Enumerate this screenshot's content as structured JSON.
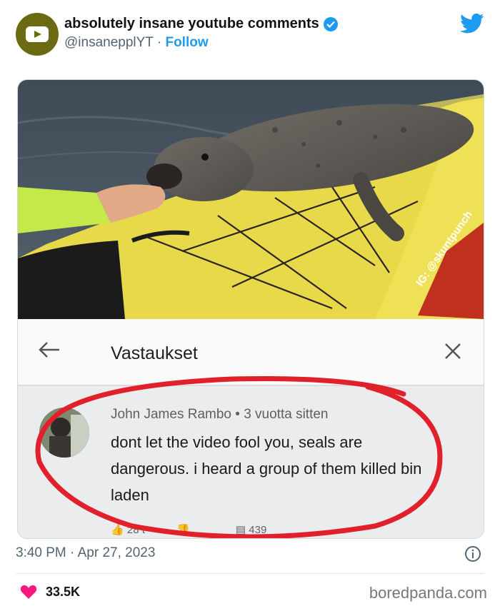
{
  "tweet": {
    "display_name": "absolutely insane youtube comments",
    "handle": "@insanepplYT",
    "separator": "·",
    "follow_label": "Follow",
    "timestamp": "3:40 PM · Apr 27, 2023",
    "likes_count": "33.5K"
  },
  "image": {
    "watermark_text": "IG: @skuntpunch",
    "youtube": {
      "panel_title": "Vastaukset",
      "comment_author": "John James Rambo",
      "comment_age": "3 vuotta sitten",
      "comment_meta_separator": "•",
      "comment_text": "dont let the video fool you, seals are dangerous. i heard a group of them killed bin laden",
      "like_count": "28 t",
      "reply_count": "439"
    }
  },
  "footer": {
    "site_watermark": "boredpanda.com"
  },
  "colors": {
    "twitter_blue": "#1d9bf0",
    "like_pink": "#f91880",
    "annotation_red": "#e0202a"
  }
}
